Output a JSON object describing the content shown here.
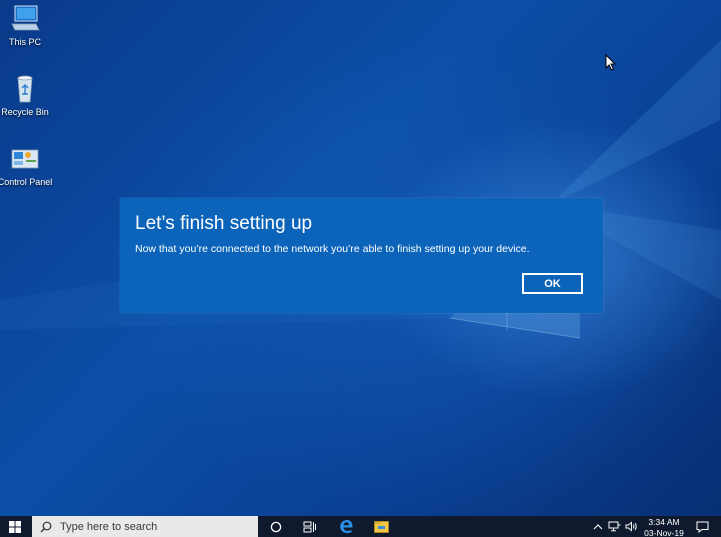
{
  "desktop": {
    "icons": [
      {
        "label": "This PC",
        "icon": "computer-icon"
      },
      {
        "label": "Recycle Bin",
        "icon": "recycle-bin-icon"
      },
      {
        "label": "Control Panel",
        "icon": "control-panel-icon"
      }
    ]
  },
  "dialog": {
    "title": "Let’s finish setting up",
    "message": "Now that you’re connected to the network you’re able to finish setting up your device.",
    "ok_label": "OK"
  },
  "taskbar": {
    "search_placeholder": "Type here to search",
    "apps": [
      "cortana-icon",
      "task-view-icon",
      "edge-icon",
      "file-explorer-icon"
    ],
    "tray": [
      "show-hidden-icons-icon",
      "network-icon",
      "volume-icon"
    ],
    "time": "3:34 AM",
    "date": "03-Nov-19"
  },
  "colors": {
    "dialog_bg": "#0b64b9",
    "taskbar_bg": "#0f1a2e",
    "desktop_bg": "#0b4fa8"
  }
}
